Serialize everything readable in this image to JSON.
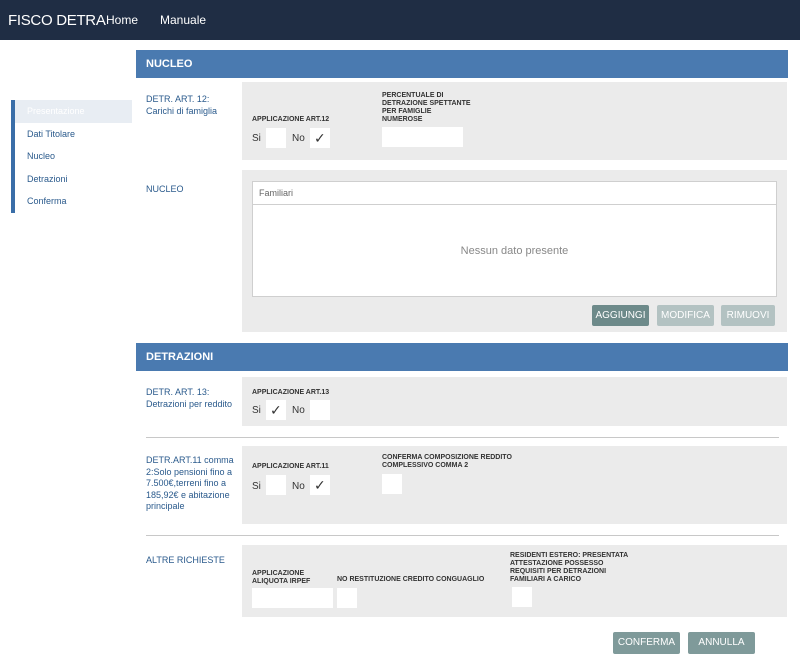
{
  "topbar": {
    "brand": "FISCO DETRA",
    "nav": [
      "Home",
      "Manuale"
    ]
  },
  "sidebar": {
    "items": [
      "Presentazione",
      "Dati Titolare",
      "Nucleo",
      "Detrazioni",
      "Conferma"
    ]
  },
  "nucleo": {
    "header": "NUCLEO",
    "art12": {
      "label": "DETR. ART. 12:\nCarichi di famiglia",
      "applicazione_label": "APPLICAZIONE ART.12",
      "si_label": "Si",
      "no_label": "No",
      "selected": "No",
      "percentuale_label": "PERCENTUALE DI DETRAZIONE SPETTANTE PER FAMIGLIE NUMEROSE",
      "percentuale_value": ""
    },
    "familiari": {
      "label": "NUCLEO",
      "grid_title": "Familiari",
      "empty_text": "Nessun dato presente",
      "buttons": {
        "add": "AGGIUNGI",
        "edit": "MODIFICA",
        "remove": "RIMUOVI"
      }
    }
  },
  "detrazioni": {
    "header": "DETRAZIONI",
    "art13": {
      "label": "DETR. ART. 13:\nDetrazioni per reddito",
      "applicazione_label": "APPLICAZIONE ART.13",
      "si_label": "Si",
      "no_label": "No",
      "selected": "Si"
    },
    "art11": {
      "label": "DETR.ART.11 comma 2:Solo pensioni fino a 7.500€,terreni fino a 185,92€ e abitazione principale",
      "applicazione_label": "APPLICAZIONE ART.11",
      "si_label": "Si",
      "no_label": "No",
      "selected": "No",
      "conferma_label": "CONFERMA COMPOSIZIONE REDDITO COMPLESSIVO COMMA 2"
    },
    "altre": {
      "label": "ALTRE RICHIESTE",
      "aliquota_label": "APPLICAZIONE ALIQUOTA IRPEF",
      "aliquota_value": "",
      "no_restituzione_label": "NO RESTITUZIONE CREDITO CONGUAGLIO",
      "residenti_label": "RESIDENTI ESTERO: PRESENTATA ATTESTAZIONE POSSESSO REQUISITI PER DETRAZIONI FAMILIARI A CARICO"
    }
  },
  "footer": {
    "confirm": "CONFERMA",
    "cancel": "ANNULLA"
  }
}
